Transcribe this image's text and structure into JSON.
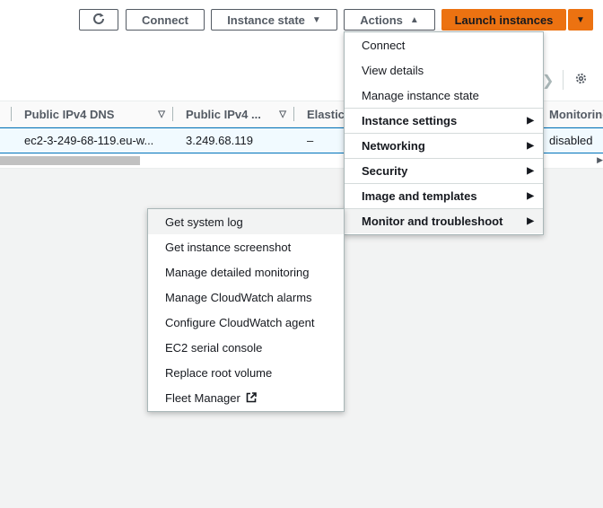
{
  "toolbar": {
    "refresh_icon": "refresh-icon",
    "connect_label": "Connect",
    "instance_state_label": "Instance state",
    "actions_label": "Actions",
    "launch_label": "Launch instances"
  },
  "table": {
    "columns": [
      {
        "label": "Public IPv4 DNS"
      },
      {
        "label": "Public IPv4 ..."
      },
      {
        "label": "Elastic"
      },
      {
        "label": "Monitoring"
      }
    ],
    "row": {
      "public_dns": "ec2-3-249-68-119.eu-w...",
      "public_ip": "3.249.68.119",
      "elastic_ip": "–",
      "monitoring": "disabled"
    }
  },
  "actions_menu": {
    "items": [
      {
        "label": "Connect",
        "type": "item"
      },
      {
        "label": "View details",
        "type": "item"
      },
      {
        "label": "Manage instance state",
        "type": "item"
      },
      {
        "label": "Instance settings",
        "type": "category"
      },
      {
        "label": "Networking",
        "type": "category"
      },
      {
        "label": "Security",
        "type": "category"
      },
      {
        "label": "Image and templates",
        "type": "category"
      },
      {
        "label": "Monitor and troubleshoot",
        "type": "category",
        "active": true
      }
    ]
  },
  "submenu": {
    "items": [
      {
        "label": "Get system log"
      },
      {
        "label": "Get instance screenshot"
      },
      {
        "label": "Manage detailed monitoring"
      },
      {
        "label": "Manage CloudWatch alarms"
      },
      {
        "label": "Configure CloudWatch agent"
      },
      {
        "label": "EC2 serial console"
      },
      {
        "label": "Replace root volume"
      },
      {
        "label": "Fleet Manager",
        "external": true
      }
    ]
  },
  "colors": {
    "accent": "#ec7211",
    "selected_row": "#f1faff",
    "selected_border": "#0073bb"
  }
}
